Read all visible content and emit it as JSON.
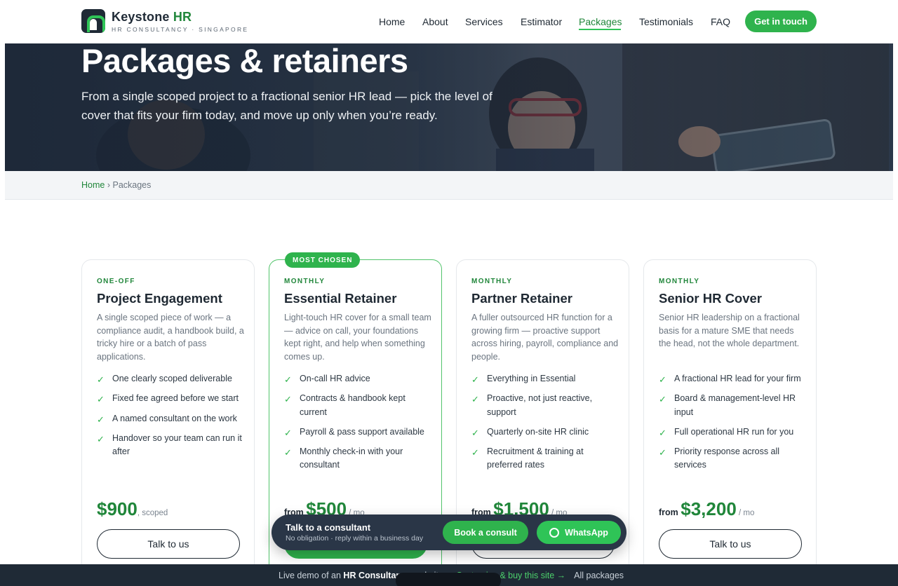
{
  "brand": {
    "name_main": "Keystone",
    "name_accent": "HR",
    "tagline": "HR CONSULTANCY · SINGAPORE"
  },
  "nav": {
    "items": [
      "Home",
      "About",
      "Services",
      "Estimator",
      "Packages",
      "Testimonials",
      "FAQ"
    ],
    "active": "Packages",
    "cta": "Get in touch"
  },
  "hero": {
    "title": "Packages & retainers",
    "description": "From a single scoped project to a fractional senior HR lead — pick the level of cover that fits your firm today, and move up only when you’re ready."
  },
  "breadcrumb": {
    "home": "Home",
    "separator": "›",
    "current": "Packages"
  },
  "packages": [
    {
      "kicker": "ONE-OFF",
      "title": "Project Engagement",
      "description": "A single scoped piece of work — a compliance audit, a handbook build, a tricky hire or a batch of pass applications.",
      "features": [
        "One clearly scoped deliverable",
        "Fixed fee agreed before we start",
        "A named consultant on the work",
        "Handover so your team can run it after"
      ],
      "price_prefix": "",
      "price": "$900",
      "price_suffix": ", scoped",
      "button": "Talk to us"
    },
    {
      "badge": "MOST CHOSEN",
      "kicker": "MONTHLY",
      "title": "Essential Retainer",
      "description": "Light-touch HR cover for a small team — advice on call, your foundations kept right, and help when something comes up.",
      "features": [
        "On-call HR advice",
        "Contracts & handbook kept current",
        "Payroll & pass support available",
        "Monthly check-in with your consultant"
      ],
      "price_prefix": "from ",
      "price": "$500",
      "price_suffix": " / mo",
      "button": ""
    },
    {
      "kicker": "MONTHLY",
      "title": "Partner Retainer",
      "description": "A fuller outsourced HR function for a growing firm — proactive support across hiring, payroll, compliance and people.",
      "features": [
        "Everything in Essential",
        "Proactive, not just reactive, support",
        "Quarterly on-site HR clinic",
        "Recruitment & training at preferred rates"
      ],
      "price_prefix": "from ",
      "price": "$1,500",
      "price_suffix": " / mo",
      "button": ""
    },
    {
      "kicker": "MONTHLY",
      "title": "Senior HR Cover",
      "description": "Senior HR leadership on a fractional basis for a mature SME that needs the head, not the whole department.",
      "features": [
        "A fractional HR lead for your firm",
        "Board & management-level HR input",
        "Full operational HR run for you",
        "Priority response across all services"
      ],
      "price_prefix": "from ",
      "price": "$3,200",
      "price_suffix": " / mo",
      "button": "Talk to us"
    }
  ],
  "floating_bar": {
    "title": "Talk to a consultant",
    "subtitle": "No obligation · reply within a business day",
    "consult_button": "Book a consult",
    "whatsapp_button": "WhatsApp"
  },
  "footer_strip": {
    "prefix": "Live demo of an ",
    "bold": "HR Consultancy",
    "mid": " website",
    "buy_link": "Customize & buy this site →",
    "all_link": "All packages"
  },
  "colors": {
    "accent": "#2fb34d",
    "accent_dark": "#20863a",
    "navy": "#1f2a36"
  }
}
